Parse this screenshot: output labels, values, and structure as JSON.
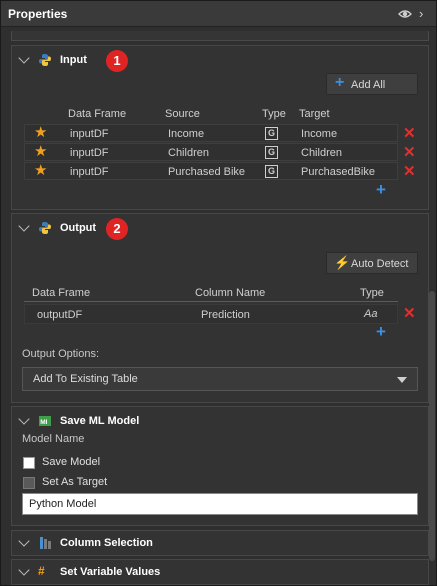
{
  "window": {
    "title": "Properties",
    "icons": [
      "eye-icon",
      "chevron-right-icon"
    ]
  },
  "input": {
    "title": "Input",
    "badge": "1",
    "add_all": "Add All",
    "headers": {
      "data_frame": "Data Frame",
      "source": "Source",
      "type": "Type",
      "target": "Target"
    },
    "rows": [
      {
        "data_frame": "inputDF",
        "source": "Income",
        "type_icon": "G",
        "target": "Income"
      },
      {
        "data_frame": "inputDF",
        "source": "Children",
        "type_icon": "G",
        "target": "Children"
      },
      {
        "data_frame": "inputDF",
        "source": "Purchased Bike",
        "type_icon": "G",
        "target": "PurchasedBike"
      }
    ]
  },
  "output": {
    "title": "Output",
    "badge": "2",
    "auto_detect": "Auto Detect",
    "headers": {
      "data_frame": "Data Frame",
      "column_name": "Column Name",
      "type": "Type"
    },
    "rows": [
      {
        "data_frame": "outputDF",
        "column_name": "Prediction",
        "type": "Aa"
      }
    ],
    "options_label": "Output Options:",
    "options_value": "Add To Existing Table"
  },
  "save_model": {
    "title": "Save ML Model",
    "model_name_label": "Model Name",
    "save_model_label": "Save Model",
    "set_as_target_label": "Set As Target",
    "model_name_value": "Python Model"
  },
  "column_selection": {
    "title": "Column Selection"
  },
  "set_variable_values": {
    "title": "Set Variable Values"
  },
  "colors": {
    "accent_blue": "#3d8fe0",
    "delete_red": "#e03030",
    "badge_red": "#e02424",
    "star_orange": "#f0a020"
  }
}
